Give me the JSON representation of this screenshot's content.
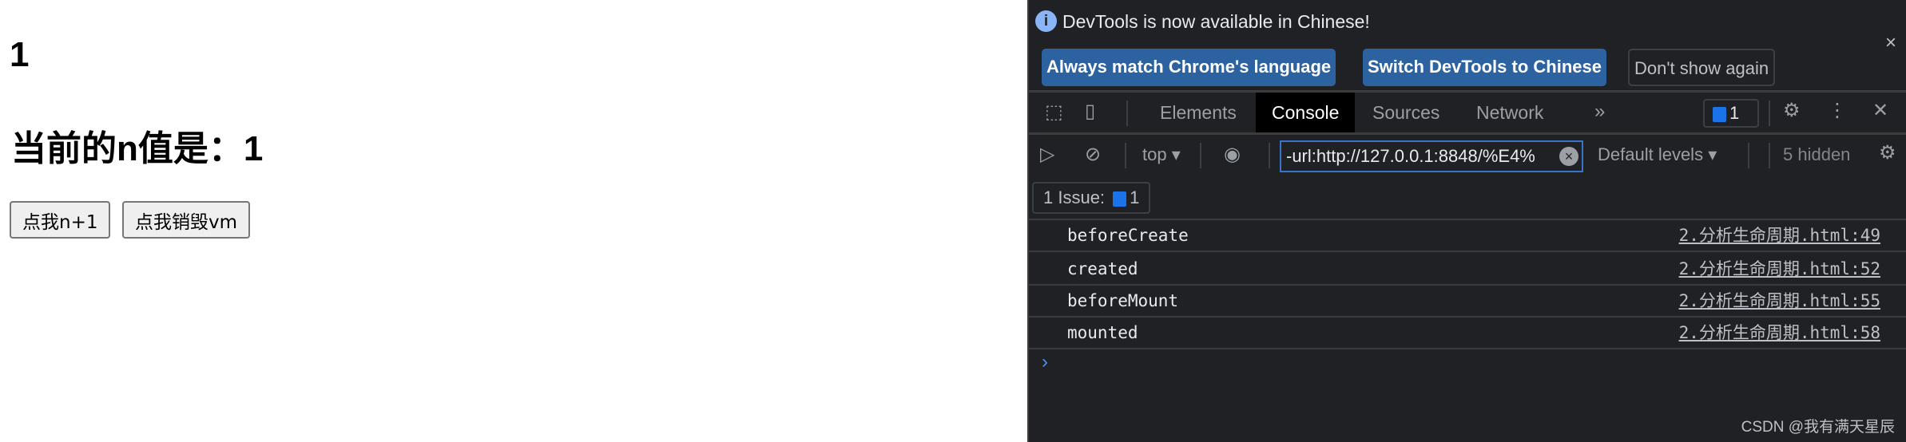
{
  "page": {
    "counter": "1",
    "n_text": "当前的n值是：1",
    "buttons": [
      "点我n+1",
      "点我销毁vm"
    ]
  },
  "devtools": {
    "infobar": {
      "message": "DevTools is now available in Chinese!",
      "buttons": [
        "Always match Chrome's language",
        "Switch DevTools to Chinese",
        "Don't show again"
      ],
      "close": "×"
    },
    "tabs": [
      "Elements",
      "Console",
      "Sources",
      "Network"
    ],
    "more_tabs": "»",
    "active_tab": "Console",
    "issues_badge": "1",
    "toolbar": {
      "context": "top",
      "filter_value": "-url:http://127.0.0.1:8848/%E4%",
      "levels": "Default levels",
      "hidden": "5 hidden"
    },
    "issue_bar": {
      "label": "1 Issue:",
      "count": "1"
    },
    "messages": [
      {
        "text": "beforeCreate",
        "source": "2.分析生命周期.html:49"
      },
      {
        "text": "created",
        "source": "2.分析生命周期.html:52"
      },
      {
        "text": "beforeMount",
        "source": "2.分析生命周期.html:55"
      },
      {
        "text": "mounted",
        "source": "2.分析生命周期.html:58"
      }
    ],
    "prompt": "›"
  },
  "watermark": "CSDN @我有满天星辰"
}
